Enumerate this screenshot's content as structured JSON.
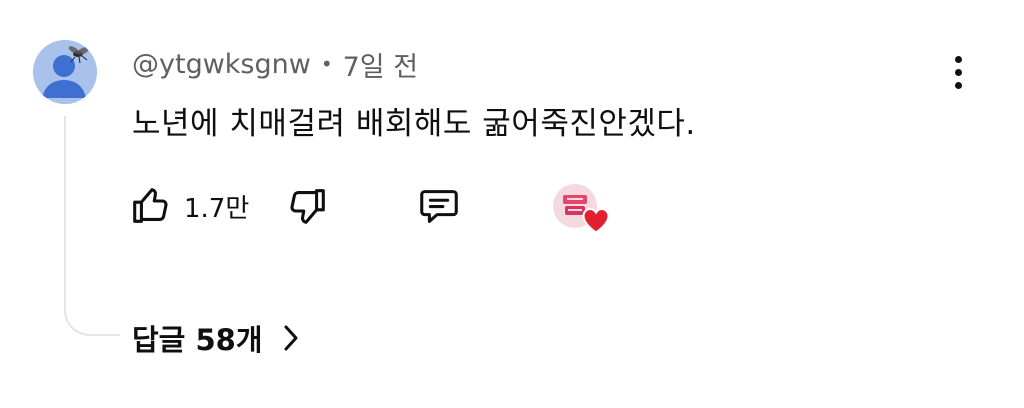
{
  "comment": {
    "author": "@ytgwksgnw",
    "separator": "•",
    "time": "7일 전",
    "text": "노년에 치매걸려 배회해도 굶어죽진안겠다.",
    "like_count": "1.7만",
    "replies_label": "답글 58개"
  },
  "icons": {
    "avatar": "default-avatar-with-fly",
    "more": "kebab-vertical-icon",
    "like": "thumbs-up-outline-icon",
    "dislike": "thumbs-down-outline-icon",
    "reply": "comment-bubble-icon",
    "creator_heart": "creator-heart-badge",
    "expand": "chevron-right-icon"
  },
  "colors": {
    "text_primary": "#0f0f0f",
    "text_secondary": "#606060",
    "avatar_bg": "#a9c2ec",
    "heart": "#e3202f",
    "thread_line": "#e5e5e5"
  }
}
